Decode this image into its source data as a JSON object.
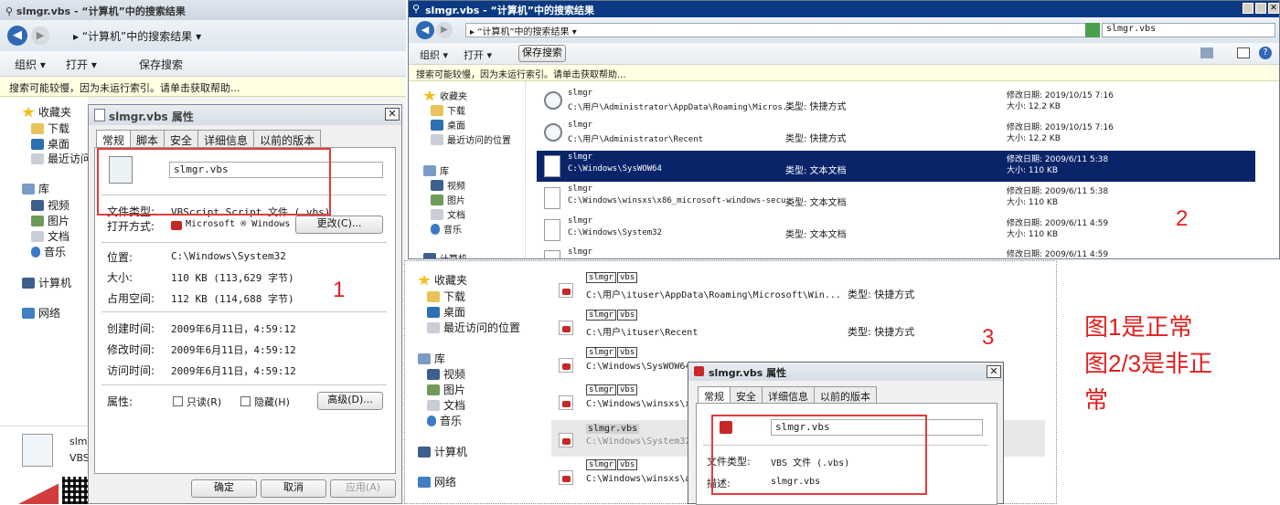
{
  "left_window": {
    "title": "slmgr.vbs - “计算机”中的搜索结果",
    "address": "▸ “计算机”中的搜索结果 ▾",
    "toolbar": {
      "organize": "组织 ▾",
      "open": "打开 ▾",
      "save_search": "保存搜索"
    },
    "info_bar": "搜索可能较慢，因为未运行索引。请单击获取帮助...",
    "nav": {
      "favorites": "收藏夹",
      "downloads": "下载",
      "desktop": "桌面",
      "recent": "最近访问",
      "libraries": "库",
      "videos": "视频",
      "pictures": "图片",
      "documents": "文档",
      "music": "音乐",
      "computer": "计算机",
      "network": "网络"
    },
    "bottom_file": {
      "name": "slm",
      "type": "VBS"
    }
  },
  "dialog1": {
    "title": "slmgr.vbs 属性",
    "tabs": [
      "常规",
      "脚本",
      "安全",
      "详细信息",
      "以前的版本"
    ],
    "file_name": "slmgr.vbs",
    "file_type_label": "文件类型:",
    "file_type_value": "VBScript Script 文件 (.vbs)",
    "open_with_label": "打开方式:",
    "open_with_value": "Microsoft ® Windows",
    "change_button": "更改(C)...",
    "location_label": "位置:",
    "location_value": "C:\\Windows\\System32",
    "size_label": "大小:",
    "size_value": "110 KB (113,629 字节)",
    "size_on_disk_label": "占用空间:",
    "size_on_disk_value": "112 KB (114,688 字节)",
    "created_label": "创建时间:",
    "created_value": "2009年6月11日，4:59:12",
    "modified_label": "修改时间:",
    "modified_value": "2009年6月11日，4:59:12",
    "accessed_label": "访问时间:",
    "accessed_value": "2009年6月11日，4:59:12",
    "attributes_label": "属性:",
    "readonly": "只读(R)",
    "hidden": "隐藏(H)",
    "advanced_button": "高级(D)...",
    "ok": "确定",
    "cancel": "取消",
    "apply": "应用(A)",
    "marker": "1"
  },
  "window2": {
    "title": "slmgr.vbs - “计算机”中的搜索结果",
    "address": "▸ “计算机”中的搜索结果 ▾",
    "search_value": "slmgr.vbs",
    "toolbar": {
      "organize": "组织 ▾",
      "open": "打开 ▾",
      "save_search": "保存搜索"
    },
    "info_bar": "搜索可能较慢，因为未运行索引。请单击获取帮助...",
    "nav": {
      "favorites": "收藏夹",
      "downloads": "下载",
      "desktop": "桌面",
      "recent": "最近访问的位置",
      "libraries": "库",
      "videos": "视频",
      "pictures": "图片",
      "documents": "文档",
      "music": "音乐",
      "computer": "计算机"
    },
    "rows": [
      {
        "name": "slmgr",
        "path": "C:\\用户\\Administrator\\AppData\\Roaming\\Micros...",
        "type": "类型: 快捷方式",
        "date": "修改日期: 2019/10/15 7:16",
        "size": "大小: 12.2 KB"
      },
      {
        "name": "slmgr",
        "path": "C:\\用户\\Administrator\\Recent",
        "type": "类型: 快捷方式",
        "date": "修改日期: 2019/10/15 7:16",
        "size": "大小: 12.2 KB"
      },
      {
        "name": "slmgr",
        "path": "C:\\Windows\\SysWOW64",
        "type": "类型: 文本文档",
        "date": "修改日期: 2009/6/11 5:38",
        "size": "大小: 110 KB"
      },
      {
        "name": "slmgr",
        "path": "C:\\Windows\\winsxs\\x86_microsoft-windows-secu...",
        "type": "类型: 文本文档",
        "date": "修改日期: 2009/6/11 5:38",
        "size": "大小: 110 KB"
      },
      {
        "name": "slmgr",
        "path": "C:\\Windows\\System32",
        "type": "类型: 文本文档",
        "date": "修改日期: 2009/6/11 4:59",
        "size": "大小: 110 KB"
      },
      {
        "name": "slmgr",
        "path": "",
        "type": "",
        "date": "修改日期: 2009/6/11 4:59",
        "size": ""
      }
    ],
    "marker": "2"
  },
  "window3": {
    "nav": {
      "favorites": "收藏夹",
      "downloads": "下载",
      "desktop": "桌面",
      "recent": "最近访问的位置",
      "libraries": "库",
      "videos": "视频",
      "pictures": "图片",
      "documents": "文档",
      "music": "音乐",
      "computer": "计算机",
      "network": "网络"
    },
    "tag_name": "slmgr",
    "tag_ext": "vbs",
    "rows": [
      {
        "path": "C:\\用户\\ituser\\AppData\\Roaming\\Microsoft\\Win...",
        "type": "类型: 快捷方式"
      },
      {
        "path": "C:\\用户\\ituser\\Recent",
        "type": "类型: 快捷方式"
      },
      {
        "path": "C:\\Windows\\SysWOW64",
        "type": ""
      },
      {
        "path": "C:\\Windows\\winsxs\\x8",
        "type": ""
      },
      {
        "path": "C:\\Windows\\System32",
        "type": "",
        "label": "slmgr.vbs"
      },
      {
        "path": "C:\\Windows\\winsxs\\am",
        "type": ""
      }
    ],
    "marker": "3"
  },
  "dialog3": {
    "title": "slmgr.vbs 属性",
    "tabs": [
      "常规",
      "安全",
      "详细信息",
      "以前的版本"
    ],
    "file_name": "slmgr.vbs",
    "file_type_label": "文件类型:",
    "file_type_value": "VBS 文件 (.vbs)",
    "desc_label": "描述:",
    "desc_value": "slmgr.vbs"
  },
  "caption": {
    "line1": "图1是正常",
    "line2": "图2/3是非正",
    "line3": "常"
  },
  "colors": {
    "highlight_red": "#e33b3b",
    "selected_row": "#0a246a",
    "title_blue": "#0b3a82"
  }
}
